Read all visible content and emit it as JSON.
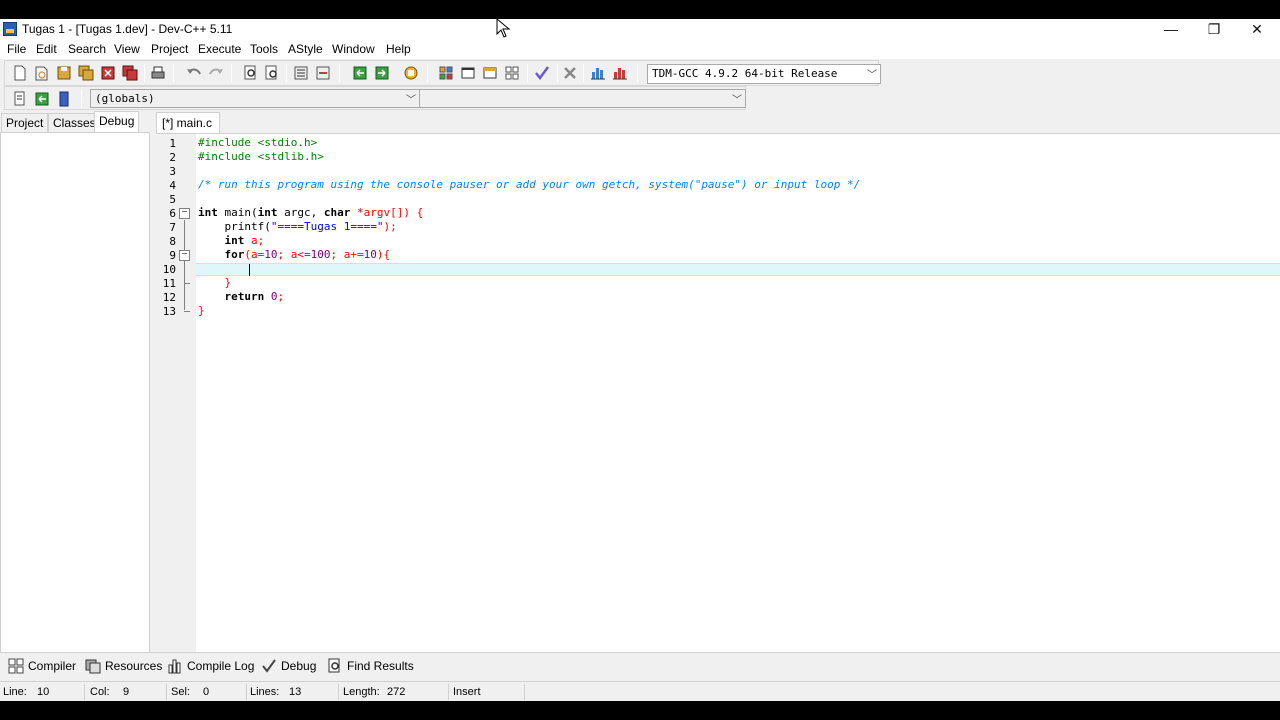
{
  "window": {
    "title": "Tugas 1 - [Tugas 1.dev] - Dev-C++ 5.11",
    "minimize": "—",
    "maximize": "❐",
    "close": "✕"
  },
  "menu": [
    "File",
    "Edit",
    "Search",
    "View",
    "Project",
    "Execute",
    "Tools",
    "AStyle",
    "Window",
    "Help"
  ],
  "toolbar": {
    "compiler": "TDM-GCC 4.9.2 64-bit Release",
    "globals": "(globals)",
    "function": ""
  },
  "left_tabs": [
    "Project",
    "Classes",
    "Debug"
  ],
  "editor": {
    "tab": "[*] main.c",
    "line_numbers": [
      "1",
      "2",
      "3",
      "4",
      "5",
      "6",
      "7",
      "8",
      "9",
      "10",
      "11",
      "12",
      "13"
    ],
    "lines": {
      "l1": "#include <stdio.h>",
      "l2": "#include <stdlib.h>",
      "l4": "/* run this program using the console pauser or add your own getch, system(\"pause\") or input loop */",
      "l6_a": "int",
      "l6_b": " main(",
      "l6_c": "int",
      "l6_d": " argc, ",
      "l6_e": "char",
      "l6_f": " *argv[]) {",
      "l7_a": "    printf(",
      "l7_b": "\"====Tugas 1====\"",
      "l7_c": ");",
      "l8_a": "    ",
      "l8_b": "int",
      "l8_c": " a;",
      "l9_a": "    ",
      "l9_b": "for",
      "l9_c": "(a=",
      "l9_d": "10",
      "l9_e": "; a<=",
      "l9_f": "100",
      "l9_g": "; a+=",
      "l9_h": "10",
      "l9_i": "){",
      "l11": "    }",
      "l12_a": "    ",
      "l12_b": "return",
      "l12_c": " ",
      "l12_d": "0",
      "l12_e": ";",
      "l13": "}"
    }
  },
  "bottom_tabs": [
    "Compiler",
    "Resources",
    "Compile Log",
    "Debug",
    "Find Results"
  ],
  "status": {
    "line_label": "Line:",
    "line_value": "10",
    "col_label": "Col:",
    "col_value": "9",
    "sel_label": "Sel:",
    "sel_value": "0",
    "lines_label": "Lines:",
    "lines_value": "13",
    "length_label": "Length:",
    "length_value": "272",
    "mode": "Insert"
  }
}
